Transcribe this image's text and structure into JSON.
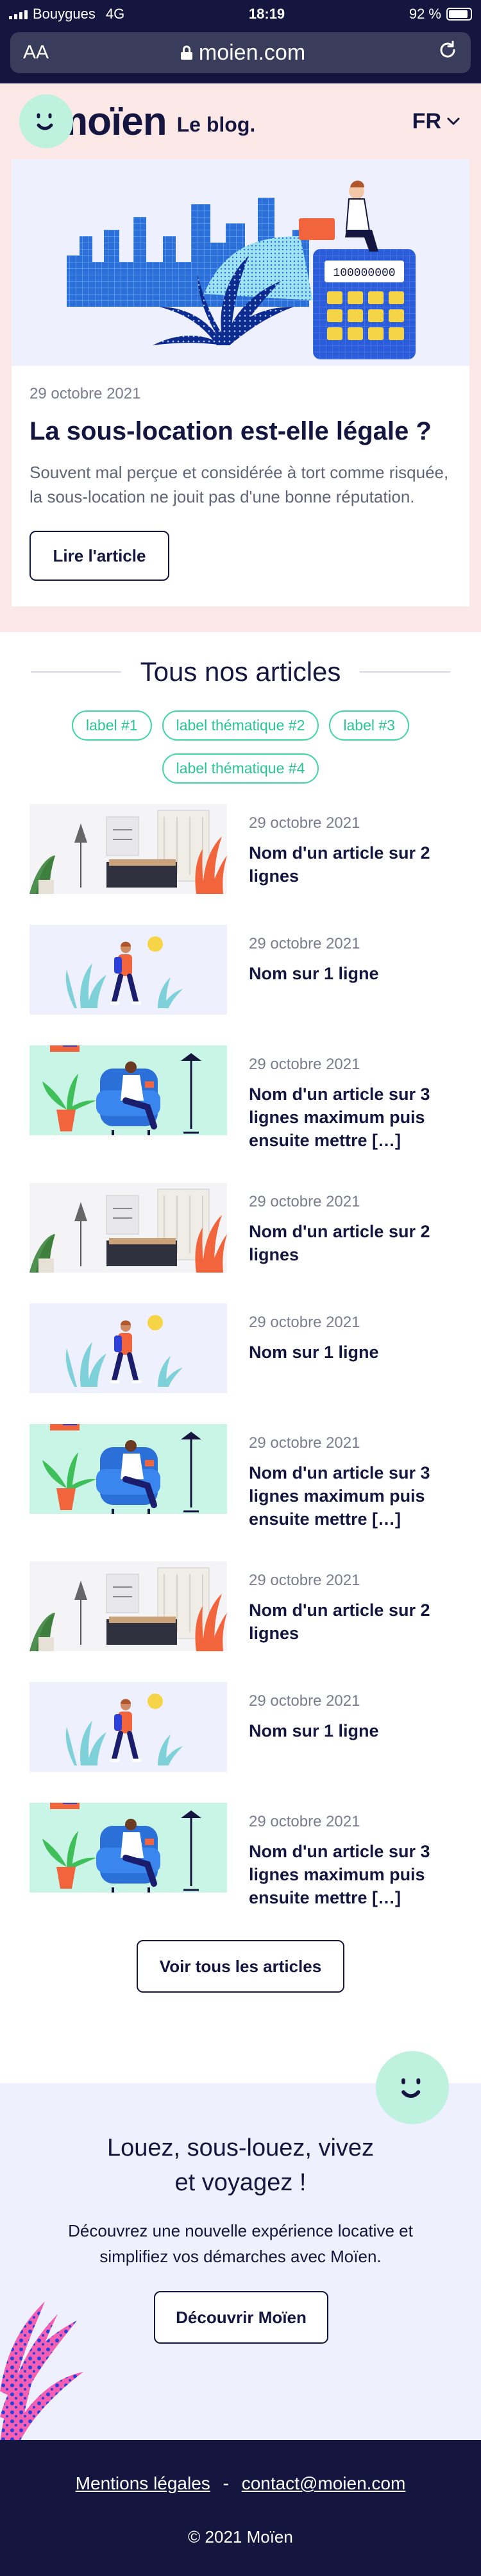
{
  "status_bar": {
    "carrier": "Bouygues",
    "network": "4G",
    "time": "18:19",
    "battery": "92 %"
  },
  "browser": {
    "aa_label": "AA",
    "url": "moien.com"
  },
  "header": {
    "logo_text": "moïen",
    "logo_sub": "Le blog.",
    "lang": "FR"
  },
  "hero": {
    "date": "29 octobre 2021",
    "title": "La sous-location est-elle légale ?",
    "description": "Souvent mal perçue et considérée à tort comme risquée, la sous-location ne jouit pas d'une bonne réputation.",
    "button": "Lire l'article",
    "calc_display": "100000000"
  },
  "section": {
    "title": "Tous nos articles",
    "chips": [
      "label #1",
      "label thématique #2",
      "label #3",
      "label thématique #4"
    ]
  },
  "articles": [
    {
      "date": "29 octobre 2021",
      "title": "Nom d'un article sur 2 lignes",
      "thumb": "room"
    },
    {
      "date": "29 octobre 2021",
      "title": "Nom sur 1 ligne",
      "thumb": "walker"
    },
    {
      "date": "29 octobre 2021",
      "title": "Nom d'un article sur 3 lignes maximum puis ensuite mettre […]",
      "thumb": "armchair"
    },
    {
      "date": "29 octobre 2021",
      "title": "Nom d'un article sur 2 lignes",
      "thumb": "room"
    },
    {
      "date": "29 octobre 2021",
      "title": "Nom sur 1 ligne",
      "thumb": "walker"
    },
    {
      "date": "29 octobre 2021",
      "title": "Nom d'un article sur 3 lignes maximum puis ensuite mettre […]",
      "thumb": "armchair"
    },
    {
      "date": "29 octobre 2021",
      "title": "Nom d'un article sur 2 lignes",
      "thumb": "room"
    },
    {
      "date": "29 octobre 2021",
      "title": "Nom sur 1 ligne",
      "thumb": "walker"
    },
    {
      "date": "29 octobre 2021",
      "title": "Nom d'un article sur 3 lignes maximum puis ensuite mettre […]",
      "thumb": "armchair"
    }
  ],
  "more_button": "Voir tous les articles",
  "cta": {
    "title_line1": "Louez, sous-louez, vivez",
    "title_line2": "et voyagez !",
    "text_line1": "Découvrez une nouvelle expérience locative et",
    "text_line2": "simplifiez vos démarches avec Moïen.",
    "button": "Découvrir Moïen"
  },
  "footer": {
    "legal": "Mentions légales",
    "separator": "-",
    "email": "contact@moien.com",
    "copyright": "© 2021 Moïen"
  },
  "colors": {
    "navy": "#14163f",
    "pink": "#fde8e8",
    "mint": "#bff2de",
    "green": "#3fd5a6",
    "lavender": "#eef0fd",
    "blue": "#2b6fd9",
    "coral": "#f2643c"
  }
}
